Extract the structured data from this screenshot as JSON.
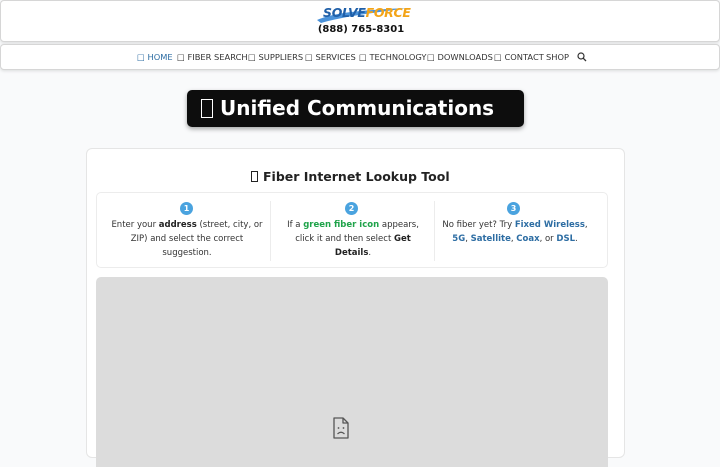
{
  "header": {
    "logo_part1": "SOLVE",
    "logo_part2": "FORCE",
    "phone": "(888) 765-8301",
    "brand_colors": {
      "blue": "#1f5fa8",
      "orange": "#f3a417"
    }
  },
  "nav": {
    "items": [
      {
        "label": "□ HOME",
        "active": true
      },
      {
        "label": "□ FIBER SEARCH"
      },
      {
        "label": "□ SUPPLIERS"
      },
      {
        "label": "□ SERVICES"
      },
      {
        "label": "□ TECHNOLOGY"
      },
      {
        "label": "□ DOWNLOADS"
      },
      {
        "label": "□ CONTACT"
      },
      {
        "label": "SHOP"
      }
    ],
    "search_icon": "magnifier-icon",
    "active_color": "#2d6da3"
  },
  "hero": {
    "title": "Unified Communications",
    "icon": "missing-glyph-icon"
  },
  "tool": {
    "title": "Fiber Internet Lookup Tool",
    "icon": "missing-glyph-icon",
    "steps": [
      {
        "num": "1",
        "t1": "Enter your ",
        "b1": "address",
        "t2": " (street, city, or ZIP) and select the correct suggestion."
      },
      {
        "num": "2",
        "t1": "If a ",
        "g1": "green fiber icon",
        "t2": " appears, click it and then select ",
        "b1": "Get Details",
        "t3": "."
      },
      {
        "num": "3",
        "t1": "No fiber yet? Try ",
        "l1": "Fixed Wireless",
        "s1": ", ",
        "l2": "5G",
        "s2": ", ",
        "l3": "Satellite",
        "s3": ", ",
        "l4": "Coax",
        "s4": ", or ",
        "l5": "DSL",
        "s5": "."
      }
    ],
    "map_icon": "broken-document-icon"
  }
}
